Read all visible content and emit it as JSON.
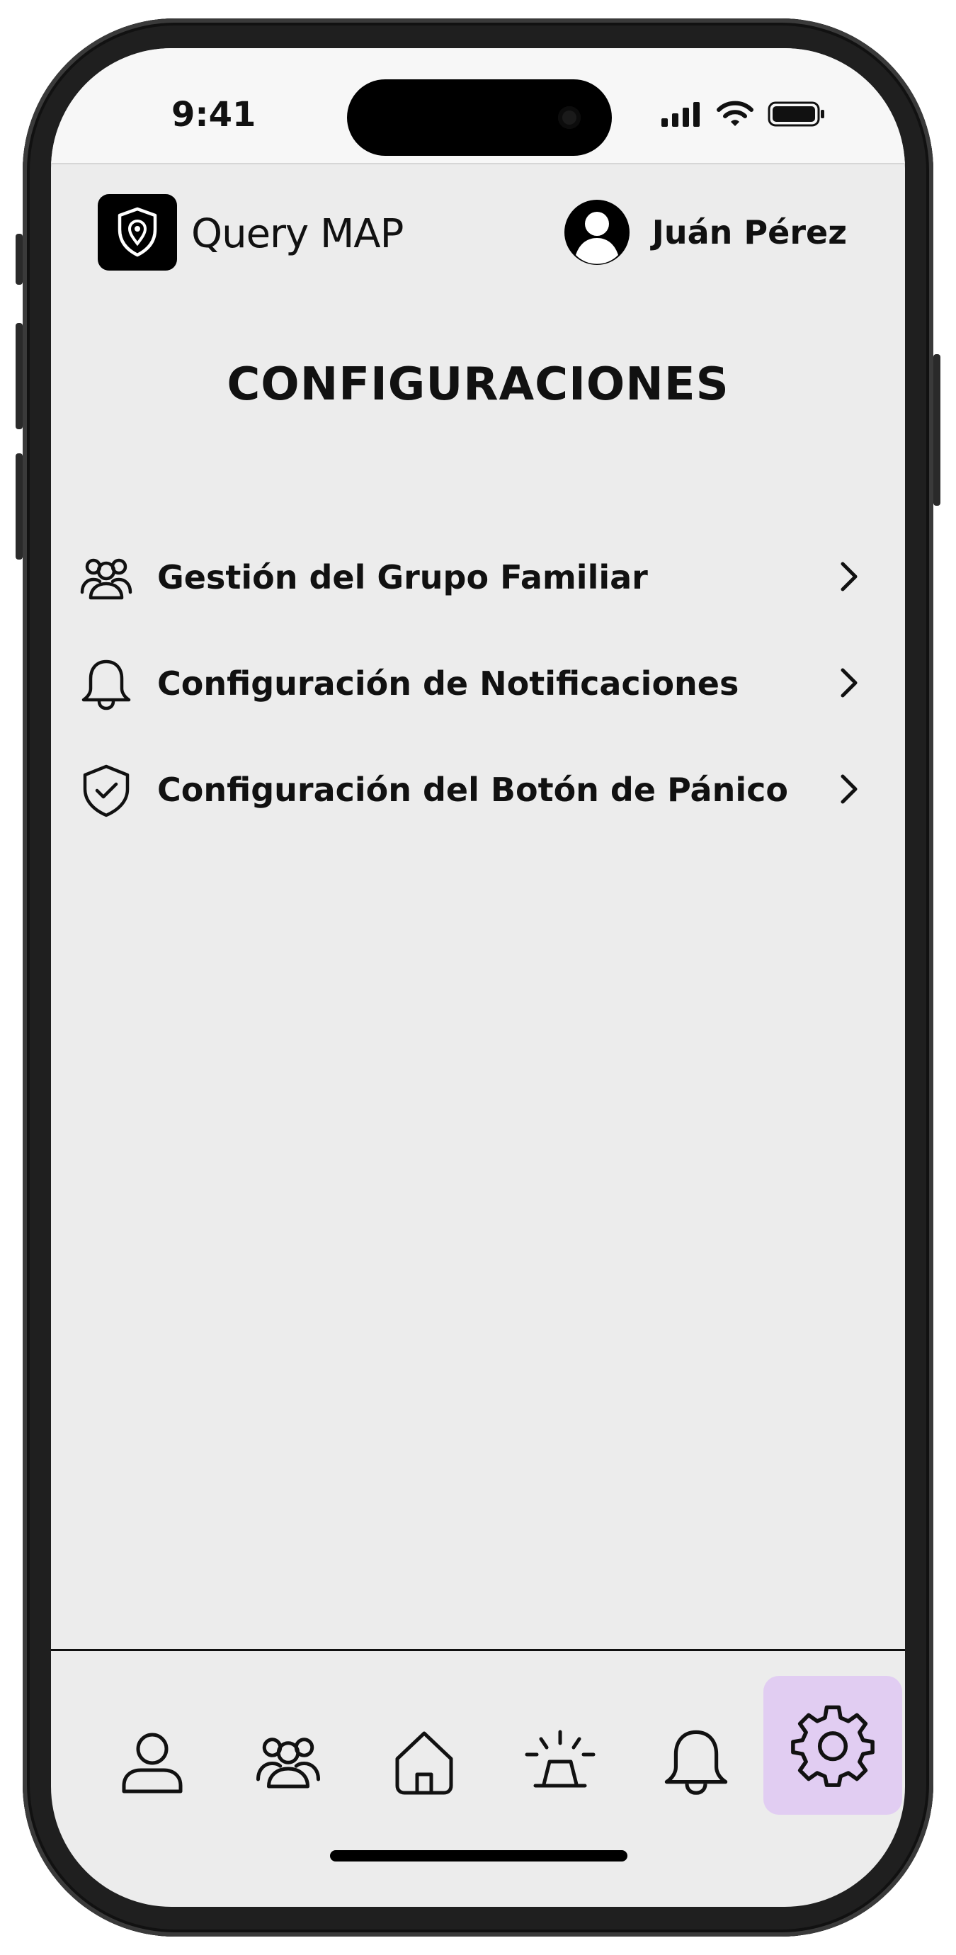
{
  "status_bar": {
    "time": "9:41"
  },
  "header": {
    "app_name": "Query MAP",
    "user_name": "Juán Pérez"
  },
  "page": {
    "title": "CONFIGURACIONES"
  },
  "menu": {
    "items": [
      {
        "label": "Gestión del Grupo Familiar",
        "icon": "users-group-icon"
      },
      {
        "label": "Configuración de Notificaciones",
        "icon": "bell-icon"
      },
      {
        "label": "Configuración del Botón de Pánico",
        "icon": "shield-check-icon"
      }
    ]
  },
  "tabbar": {
    "tabs": [
      {
        "icon": "user-icon",
        "active": false
      },
      {
        "icon": "users-group-icon",
        "active": false
      },
      {
        "icon": "home-icon",
        "active": false
      },
      {
        "icon": "siren-icon",
        "active": false
      },
      {
        "icon": "bell-icon",
        "active": false
      },
      {
        "icon": "gear-icon",
        "active": true
      }
    ],
    "active_color": "#e1cdf2"
  },
  "colors": {
    "screen_bg": "#ececec",
    "text": "#111111",
    "accent": "#e1cdf2"
  }
}
